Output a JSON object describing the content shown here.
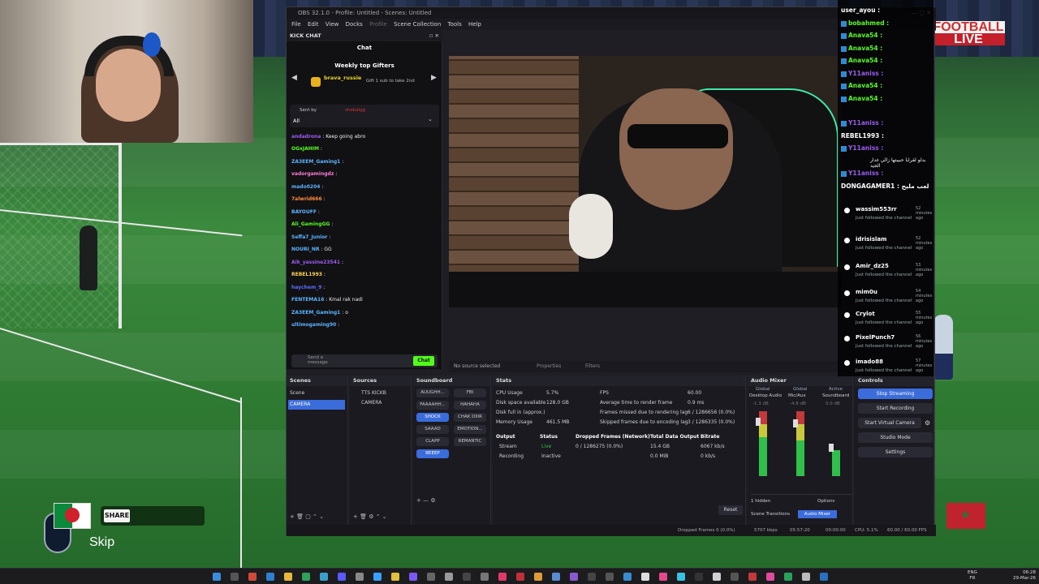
{
  "obs": {
    "title": "OBS 32.1.0 - Profile: Untitled - Scenes: Untitled",
    "menu": [
      "File",
      "Edit",
      "View",
      "Docks",
      "Profile",
      "Scene Collection",
      "Tools",
      "Help"
    ],
    "kick_chat": {
      "panel_title": "KICK CHAT",
      "tab_label": "Chat",
      "gifters_title": "Weekly top Gifters",
      "gifter_name": "brava_russie",
      "gift_cta": "Gift 1 sub to take 2nd",
      "pinned_label": "Sent by",
      "pinned_user": "shabalgg",
      "filter_value": "All",
      "messages": [
        {
          "user": "andadrona",
          "text": "Keep going abro"
        },
        {
          "user": "OGxJAHIM",
          "text": ""
        },
        {
          "user": "ZA3EEM_Gaming1",
          "text": ""
        },
        {
          "user": "vadorgamingdz",
          "text": ""
        },
        {
          "user": "mado0204",
          "text": ""
        },
        {
          "user": "7alwrid666",
          "text": ""
        },
        {
          "user": "BAYOUFF",
          "text": ""
        },
        {
          "user": "Ali_GamingGG",
          "text": ""
        },
        {
          "user": "Seffa7_Junior",
          "text": ""
        },
        {
          "user": "NOURI_NR",
          "text": "GG"
        },
        {
          "user": "Aik_yassine23541",
          "text": ""
        },
        {
          "user": "REBEL1993",
          "text": ""
        },
        {
          "user": "haychem_9",
          "text": ""
        },
        {
          "user": "FENTEMA16",
          "text": "Kmal rak nadi"
        },
        {
          "user": "ZA3EEM_Gaming1",
          "text": "o"
        },
        {
          "user": "ultimogaming90",
          "text": ""
        }
      ],
      "input_placeholder": "Send a message",
      "send_button": "Chat"
    },
    "preview": {
      "no_source": "No source selected",
      "properties": "Properties",
      "filters": "Filters"
    },
    "scenes": {
      "title": "Scenes",
      "items": [
        "Scene",
        "CAMERA"
      ],
      "selected": "CAMERA"
    },
    "sources": {
      "title": "Sources",
      "items": [
        "TTS KICKB",
        "CAMERA"
      ]
    },
    "soundboard": {
      "title": "Soundboard",
      "buttons": [
        "AUUGHH...",
        "FBI",
        "FAAAAHH...",
        "HAHAHA",
        "SHOCK",
        "CHAK DIIIR",
        "SAAAD",
        "EMOTION...",
        "CLAPP",
        "REMANTIC",
        "BEEEP"
      ],
      "active": [
        "SHOCK",
        "BEEEP"
      ]
    },
    "stats": {
      "title": "Stats",
      "rows_left": [
        {
          "label": "CPU Usage",
          "value": "5.7%"
        },
        {
          "label": "Disk space available",
          "value": "128.0 GB"
        },
        {
          "label": "Disk full in (approx.)",
          "value": ""
        },
        {
          "label": "Memory Usage",
          "value": "461.5 MB"
        }
      ],
      "rows_right": [
        {
          "label": "FPS",
          "value": "60.00"
        },
        {
          "label": "Average time to render frame",
          "value": "0.9 ms"
        },
        {
          "label": "Frames missed due to rendering lag",
          "value": "6 / 1286656 (0.0%)"
        },
        {
          "label": "Skipped frames due to encoding lag",
          "value": "3 / 1286335 (0.0%)"
        }
      ],
      "table_headers": [
        "Output",
        "Status",
        "Dropped Frames (Network)",
        "Total Data Output",
        "Bitrate"
      ],
      "table_rows": [
        {
          "output": "Stream",
          "status": "Live",
          "dropped": "0 / 1286275 (0.0%)",
          "total": "15.4 GB",
          "bitrate": "6067 kb/s"
        },
        {
          "output": "Recording",
          "status": "Inactive",
          "dropped": "",
          "total": "0.0 MiB",
          "bitrate": "0 kb/s"
        }
      ],
      "reset": "Reset"
    },
    "mixer": {
      "title": "Audio Mixer",
      "channels": [
        {
          "tag": "Global",
          "name": "Desktop Audio",
          "db": "-1.3 dB"
        },
        {
          "tag": "Global",
          "name": "Mic/Aux",
          "db": "-4.8 dB"
        },
        {
          "tag": "Active",
          "name": "Soundboard",
          "db": "0.0 dB"
        }
      ],
      "hidden_count": "1 hidden",
      "options": "Options",
      "scene_transitions": "Scene Transitions",
      "audio_mixer_tab": "Audio Mixer"
    },
    "controls": {
      "title": "Controls",
      "buttons": [
        "Stop Streaming",
        "Start Recording",
        "Start Virtual Camera",
        "Studio Mode",
        "Settings"
      ]
    },
    "statusbar": {
      "dropped": "Dropped Frames 0 (0.0%)",
      "kbps": "5707 kbps",
      "timer": "05:57:20",
      "rec": "00:00:00",
      "cpu": "CPU: 5.1%",
      "fps": "60.00 / 60.00 FPS"
    }
  },
  "overlay_chat": {
    "lines": [
      "user_ayou :",
      "bobahmed :",
      "Anava54 :",
      "Anava54 :",
      "Anava54 :",
      "Y11aniss :",
      "Anava54 :",
      "Anava54 :",
      "Y11aniss :",
      "REBEL1993 :",
      "Y11aniss :",
      "Y11aniss :"
    ],
    "dong": "DONGAGAMER1 :",
    "dong_msg": "لعب مليح",
    "arabic_msg": "بدلو لقرايا حبيبتها زالي غدار الجيد",
    "followers": [
      {
        "name": "wassim553rr",
        "ago": "52 minutes ago"
      },
      {
        "name": "idrisislam",
        "ago": "52 minutes ago"
      },
      {
        "name": "Amir_dz25",
        "ago": "53 minutes ago"
      },
      {
        "name": "mim0u",
        "ago": "54 minutes ago"
      },
      {
        "name": "Crylot",
        "ago": "55 minutes ago"
      },
      {
        "name": "PixelPunch7",
        "ago": "56 minutes ago"
      },
      {
        "name": "imado88",
        "ago": "57 minutes ago"
      }
    ],
    "follow_text": "Just followed the channel"
  },
  "overlay": {
    "share": "SHARE",
    "skip": "Skip",
    "ball_top": "FOOTBALL",
    "ball_live": "LIVE"
  },
  "taskbar": {
    "lang": "ENG",
    "region": "FR",
    "time": "06:28",
    "date": "29-Mar-26"
  }
}
